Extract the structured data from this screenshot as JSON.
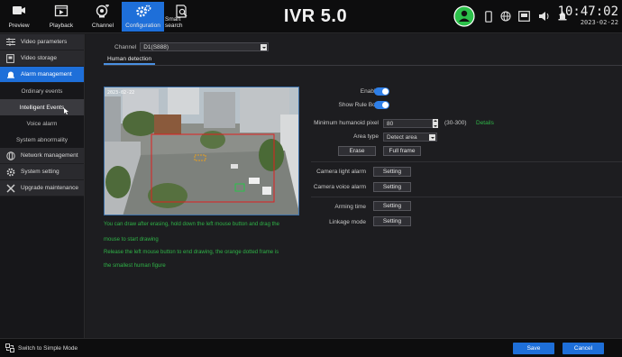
{
  "topbar": {
    "buttons": [
      {
        "label": "Preview",
        "icon": "preview-camera-icon"
      },
      {
        "label": "Playback",
        "icon": "playback-film-icon"
      },
      {
        "label": "Channel",
        "icon": "channel-camera-add-icon"
      },
      {
        "label": "Configuration",
        "icon": "configuration-gears-icon",
        "active": true
      },
      {
        "label": "Smart search",
        "icon": "smart-search-icon"
      }
    ],
    "title": "IVR 5.0",
    "status_icons": [
      "user-online-icon",
      "phone-icon",
      "network-globe-icon",
      "hdd-icon",
      "volume-icon",
      "alarm-bell-icon"
    ],
    "time": "10:47:02",
    "date": "2023-02-22"
  },
  "sidebar": {
    "items": [
      {
        "label": "Video parameters",
        "icon": "video-parameters-icon"
      },
      {
        "label": "Video storage",
        "icon": "video-storage-icon"
      },
      {
        "label": "Alarm management",
        "icon": "alarm-bell-icon",
        "active": true
      },
      {
        "label": "Ordinary events",
        "sub": true
      },
      {
        "label": "Intelligent Events",
        "sub": true,
        "active": true
      },
      {
        "label": "Voice alarm",
        "sub": true
      },
      {
        "label": "System abnormality",
        "sub": true
      },
      {
        "label": "Network management",
        "icon": "network-globe-icon"
      },
      {
        "label": "System setting",
        "icon": "system-gear-icon"
      },
      {
        "label": "Upgrade maintenance",
        "icon": "upgrade-tools-icon"
      }
    ]
  },
  "main": {
    "channel_label": "Channel",
    "channel_value": "D1(S888)",
    "tab": "Human detection",
    "video_timestamp": "2023-02-22",
    "hints": [
      "You can draw after erasing, hold down the left mouse button and drag the",
      "mouse to start drawing",
      "Release the left mouse button to end drawing, the orange dotted frame is",
      "the smallest human figure"
    ],
    "settings": {
      "enable_label": "Enable",
      "enable_on": true,
      "show_rule_box_label": "Show Rule Box",
      "show_rule_box_on": true,
      "min_pixel_label": "Minimum humanoid pixel",
      "min_pixel_value": "80",
      "min_pixel_range": "(30-300)",
      "details_label": "Details",
      "area_type_label": "Area type",
      "area_type_value": "Detect area",
      "erase_label": "Erase",
      "full_frame_label": "Full frame",
      "camera_light_alarm_label": "Camera light alarm",
      "camera_voice_alarm_label": "Camera voice alarm",
      "arming_time_label": "Arming time",
      "linkage_mode_label": "Linkage mode",
      "setting_label": "Setting"
    }
  },
  "footer": {
    "simple_mode": "Switch to Simple Mode",
    "save": "Save",
    "cancel": "Cancel"
  },
  "colors": {
    "accent": "#1e6fd9",
    "toggle_on": "#2e7fe8",
    "hint_green": "#2fb347",
    "detect_red": "#e02020"
  }
}
